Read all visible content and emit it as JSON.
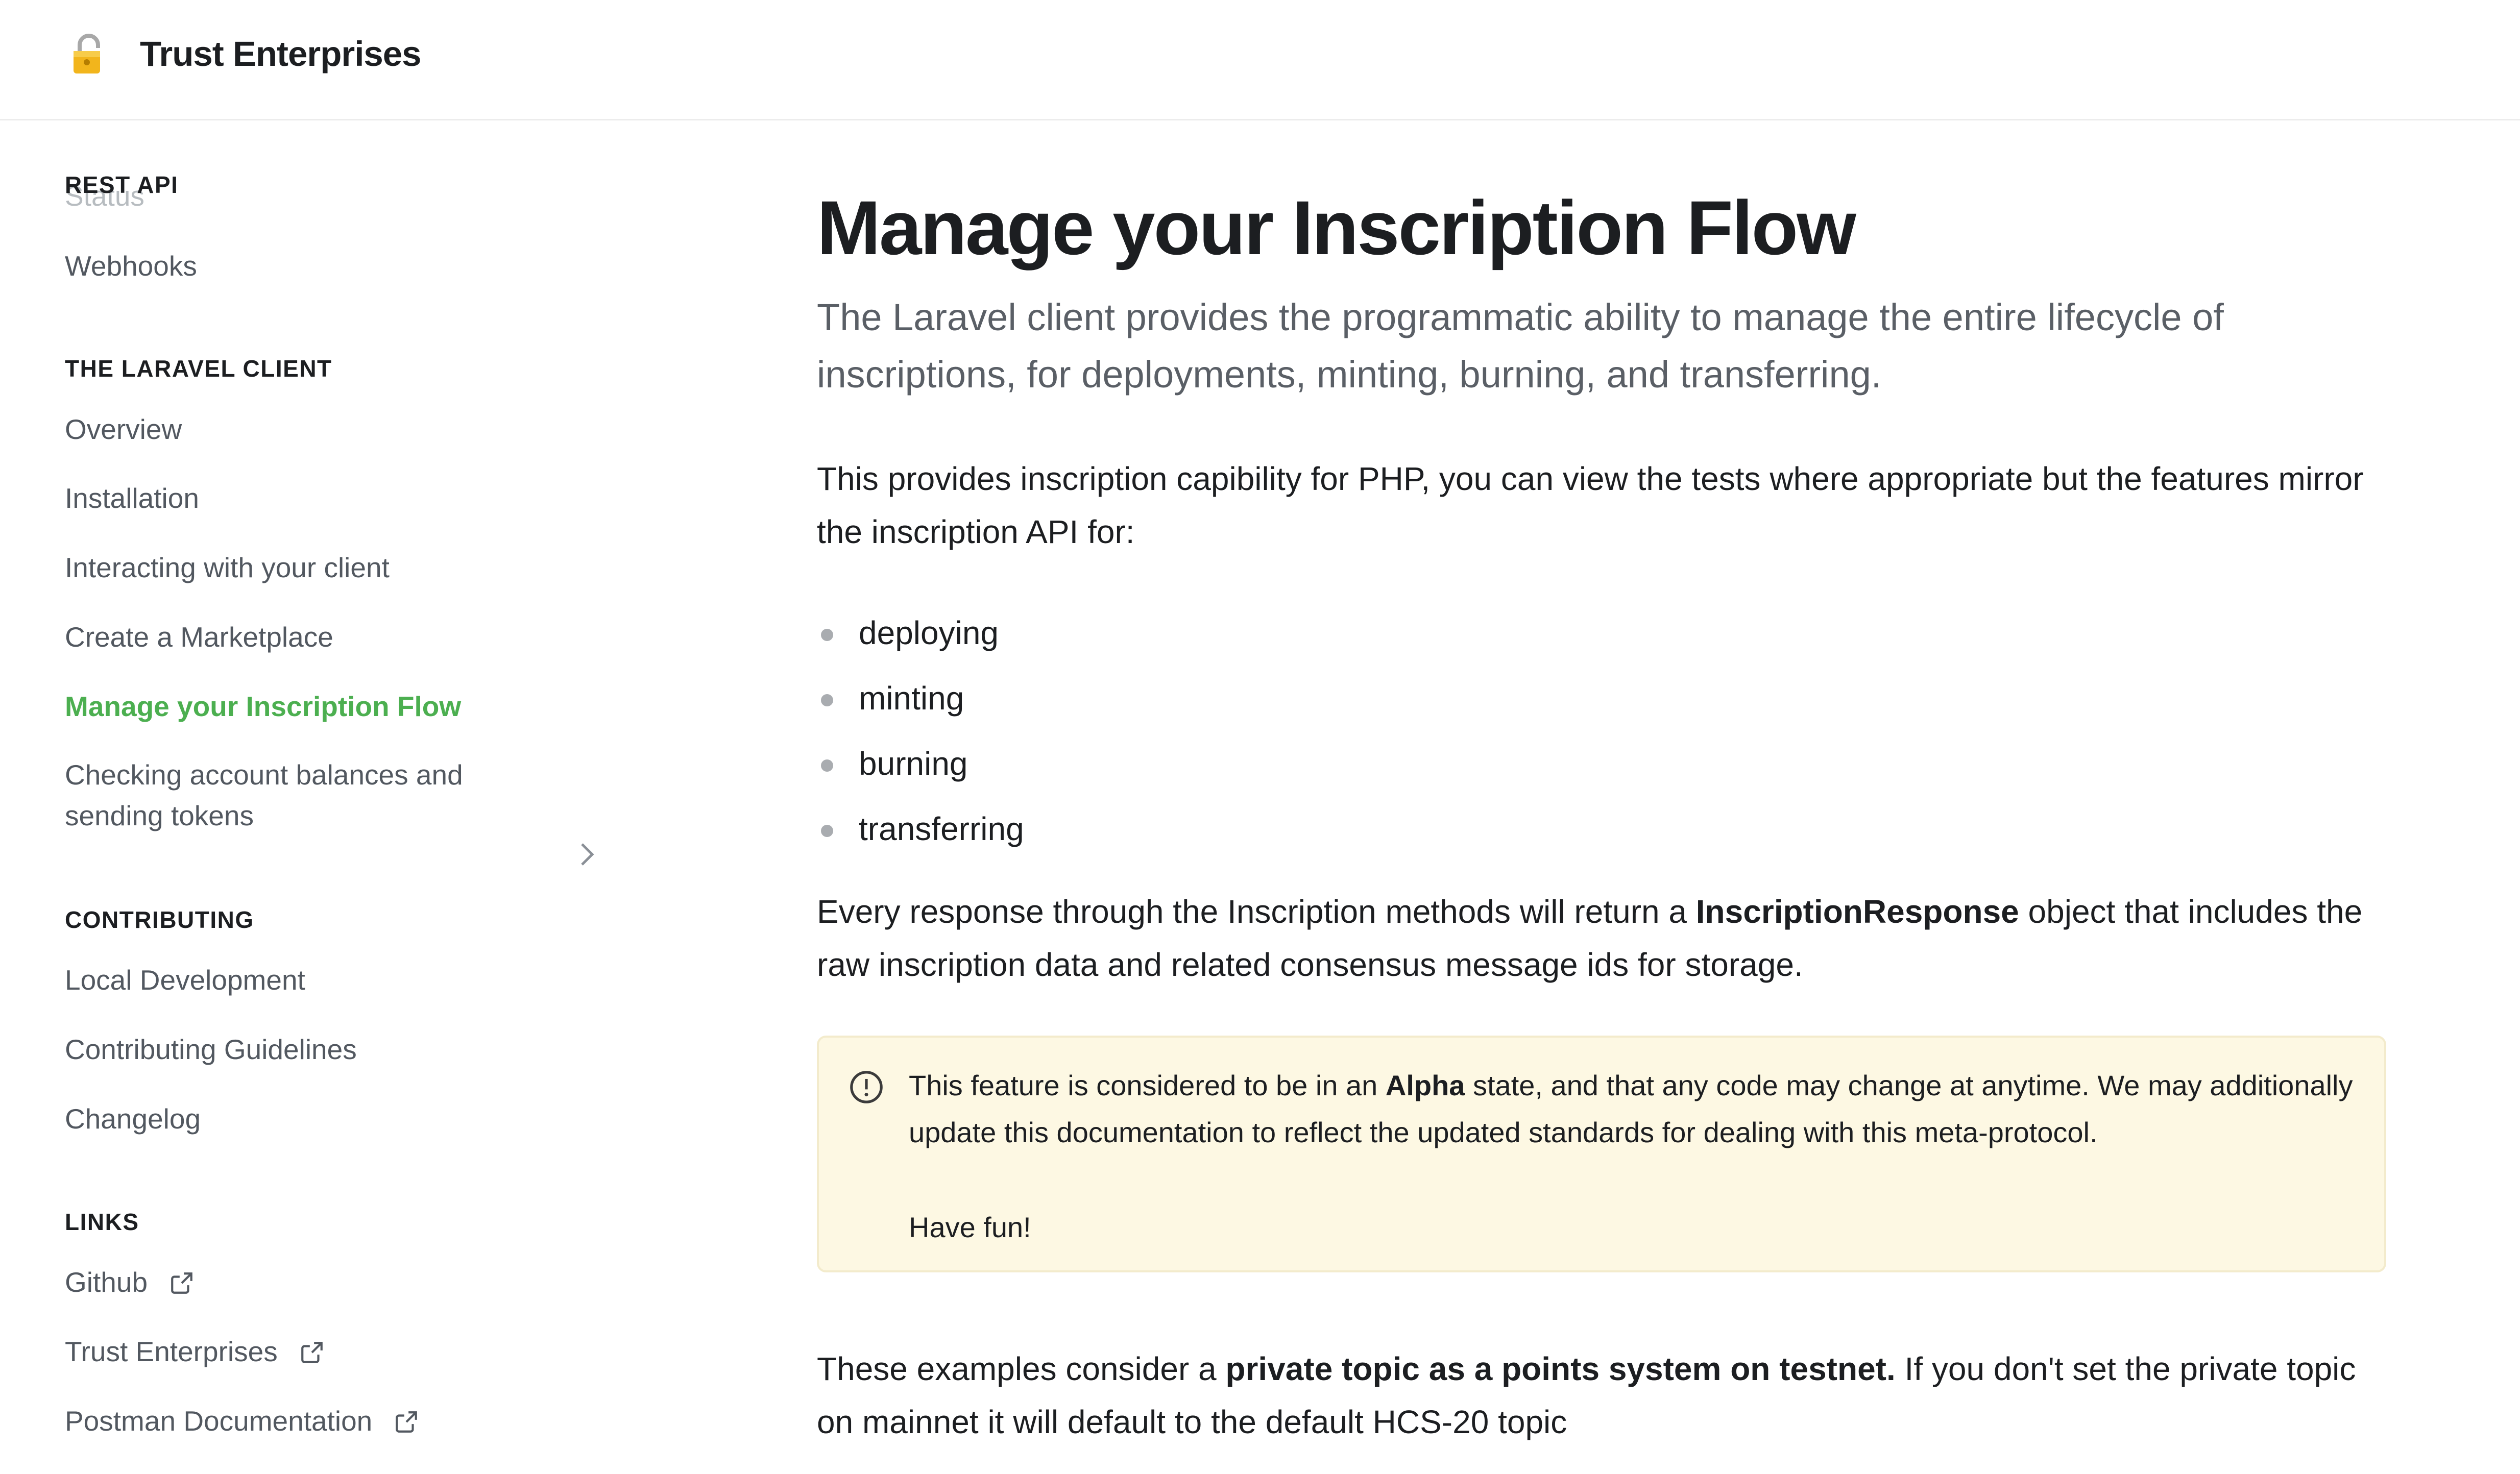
{
  "navbar": {
    "brand": "Trust Enterprises",
    "logo_icon": "lock-icon"
  },
  "sidebar": {
    "rest_api": {
      "header": "REST API",
      "faded_item": "Status",
      "items": [
        "Webhooks"
      ]
    },
    "laravel": {
      "header": "THE LARAVEL CLIENT",
      "items": [
        "Overview",
        "Installation",
        "Interacting with your client",
        "Create a Marketplace",
        "Manage your Inscription Flow",
        "Checking account balances and sending tokens"
      ],
      "active": "Manage your Inscription Flow"
    },
    "contributing": {
      "header": "CONTRIBUTING",
      "items": [
        "Local Development",
        "Contributing Guidelines",
        "Changelog"
      ]
    },
    "links": {
      "header": "LINKS",
      "items": [
        "Github",
        "Trust Enterprises",
        "Postman Documentation"
      ]
    }
  },
  "main": {
    "title": "Manage your Inscription Flow",
    "lead": "The Laravel client provides the programmatic ability to manage the entire lifecycle of inscriptions, for deployments, minting, burning, and transferring.",
    "intro": "This provides inscription capibility for PHP, you can view the tests where appropriate but the features mirror the inscription API for:",
    "bullets": [
      "deploying",
      "minting",
      "burning",
      "transferring"
    ],
    "response": {
      "before": "Every response through the Inscription methods will return a ",
      "bold": "InscriptionResponse",
      "after": " object that includes the raw inscription data and related consensus message ids for storage."
    },
    "admonition": {
      "icon": "info-circle-icon",
      "before": "This feature is considered to be in an ",
      "bold": "Alpha",
      "after": " state, and that any code may change at anytime. We may additionally update this documentation to reflect the updated standards for dealing with this meta-protocol.",
      "fun": "Have fun!",
      "background": "#fdf8e3"
    },
    "examples": {
      "before": "These examples consider a ",
      "bold": "private topic as a points system on testnet.",
      "after": " If you don't set the private topic on mainnet it will default to the default HCS-20 topic"
    }
  },
  "colors": {
    "accent": "#4caf50",
    "text": "#1c1e21",
    "muted": "#525860"
  }
}
